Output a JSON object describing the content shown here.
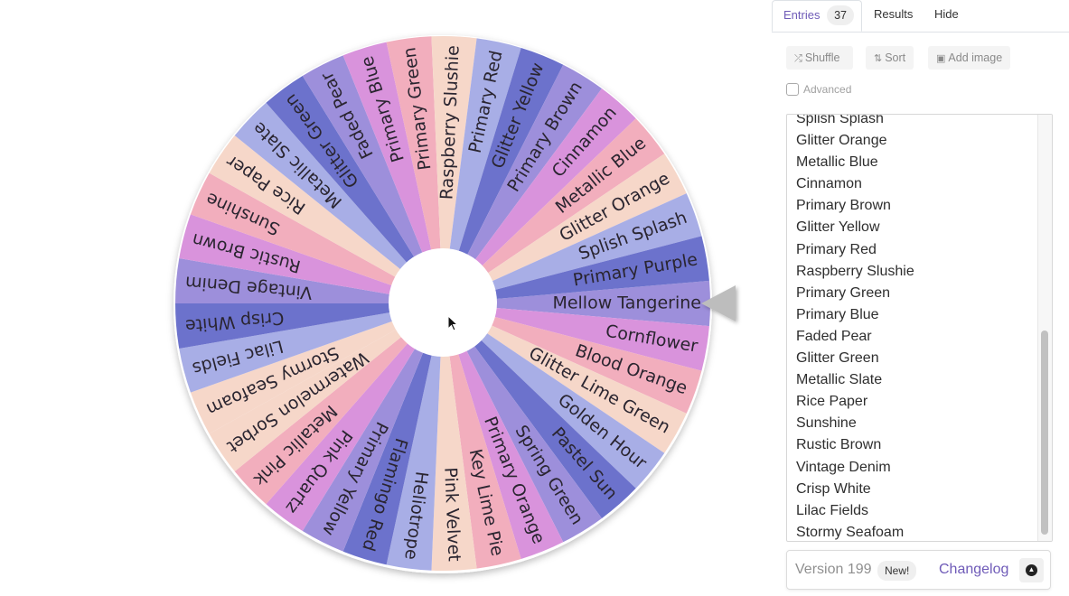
{
  "wheel": {
    "segments": [
      {
        "label": "Mellow Tangerine",
        "color": "#9d8fdb"
      },
      {
        "label": "Cornflower",
        "color": "#d993dc"
      },
      {
        "label": "Blood Orange",
        "color": "#f2aebd"
      },
      {
        "label": "Glitter Lime Green",
        "color": "#f6d7c9"
      },
      {
        "label": "Golden Hour",
        "color": "#a8aee6"
      },
      {
        "label": "Pastel Sun",
        "color": "#6c72cc"
      },
      {
        "label": "Spring Green",
        "color": "#9d8fdb"
      },
      {
        "label": "Primary Orange",
        "color": "#d993dc"
      },
      {
        "label": "Key Lime Pie",
        "color": "#f2aebd"
      },
      {
        "label": "Pink Velvet",
        "color": "#f6d7c9"
      },
      {
        "label": "Heliotrope",
        "color": "#a8aee6"
      },
      {
        "label": "Flamingo Red",
        "color": "#6c72cc"
      },
      {
        "label": "Primary Yellow",
        "color": "#9d8fdb"
      },
      {
        "label": "Pink Quartz",
        "color": "#d993dc"
      },
      {
        "label": "Metallic Pink",
        "color": "#f2aebd"
      },
      {
        "label": "Watermelon Sorbet",
        "color": "#f6d7c9"
      },
      {
        "label": "Stormy Seafoam",
        "color": "#f6d7c9"
      },
      {
        "label": "Lilac Fields",
        "color": "#a8aee6"
      },
      {
        "label": "Crisp White",
        "color": "#6c72cc"
      },
      {
        "label": "Vintage Denim",
        "color": "#9d8fdb"
      },
      {
        "label": "Rustic Brown",
        "color": "#d993dc"
      },
      {
        "label": "Sunshine",
        "color": "#f2aebd"
      },
      {
        "label": "Rice Paper",
        "color": "#f6d7c9"
      },
      {
        "label": "Metallic Slate",
        "color": "#a8aee6"
      },
      {
        "label": "Glitter Green",
        "color": "#6c72cc"
      },
      {
        "label": "Faded Pear",
        "color": "#9d8fdb"
      },
      {
        "label": "Primary Blue",
        "color": "#d993dc"
      },
      {
        "label": "Primary Green",
        "color": "#f2aebd"
      },
      {
        "label": "Raspberry Slushie",
        "color": "#f6d7c9"
      },
      {
        "label": "Primary Red",
        "color": "#a8aee6"
      },
      {
        "label": "Glitter Yellow",
        "color": "#6c72cc"
      },
      {
        "label": "Primary Brown",
        "color": "#9d8fdb"
      },
      {
        "label": "Cinnamon",
        "color": "#d993dc"
      },
      {
        "label": "Metallic Blue",
        "color": "#f2aebd"
      },
      {
        "label": "Glitter Orange",
        "color": "#f6d7c9"
      },
      {
        "label": "Splish Splash",
        "color": "#a8aee6"
      },
      {
        "label": "Primary Purple",
        "color": "#6c72cc"
      }
    ],
    "pointer_color": "#bdbdbd",
    "center_color": "#ffffff"
  },
  "tabs": {
    "entries": {
      "label": "Entries",
      "count": "37"
    },
    "results": {
      "label": "Results"
    },
    "hide": {
      "label": "Hide"
    }
  },
  "toolbar": {
    "shuffle_label": "Shuffle",
    "sort_label": "Sort",
    "add_image_label": "Add image",
    "advanced_label": "Advanced",
    "advanced_checked": false
  },
  "entries_visible": [
    "Splish Splash",
    "Glitter Orange",
    "Metallic Blue",
    "Cinnamon",
    "Primary Brown",
    "Glitter Yellow",
    "Primary Red",
    "Raspberry Slushie",
    "Primary Green",
    "Primary Blue",
    "Faded Pear",
    "Glitter Green",
    "Metallic Slate",
    "Rice Paper",
    "Sunshine",
    "Rustic Brown",
    "Vintage Denim",
    "Crisp White",
    "Lilac Fields",
    "Stormy Seafoam"
  ],
  "footer": {
    "version_label": "Version 199",
    "new_badge": "New!",
    "changelog_label": "Changelog"
  },
  "colors": {
    "accent": "#6f5bb8"
  }
}
